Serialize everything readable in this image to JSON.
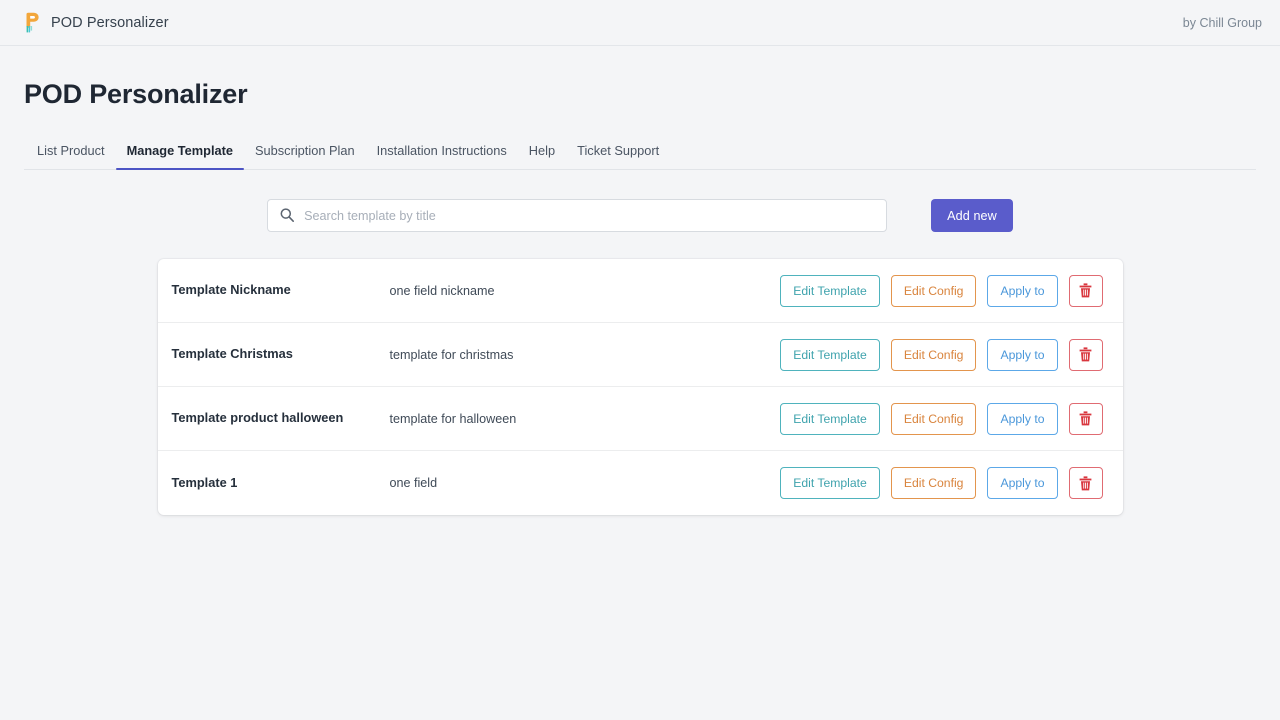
{
  "topbar": {
    "logo_icon": "pod-logo-icon",
    "brand_name": "POD Personalizer",
    "byline": "by Chill Group"
  },
  "page": {
    "title": "POD Personalizer"
  },
  "tabs": [
    {
      "label": "List Product",
      "active": false
    },
    {
      "label": "Manage Template",
      "active": true
    },
    {
      "label": "Subscription Plan",
      "active": false
    },
    {
      "label": "Installation Instructions",
      "active": false
    },
    {
      "label": "Help",
      "active": false
    },
    {
      "label": "Ticket Support",
      "active": false
    }
  ],
  "toolbar": {
    "search": {
      "icon": "search-icon",
      "value": "",
      "placeholder": "Search template by title"
    },
    "add_new_label": "Add new"
  },
  "table": {
    "rows": [
      {
        "title": "Template Nickname",
        "description": "one field nickname",
        "actions": {
          "edit_template": "Edit Template",
          "edit_config": "Edit Config",
          "apply_to": "Apply to",
          "delete_icon": "trash-icon"
        }
      },
      {
        "title": "Template Christmas",
        "description": "template for christmas",
        "actions": {
          "edit_template": "Edit Template",
          "edit_config": "Edit Config",
          "apply_to": "Apply to",
          "delete_icon": "trash-icon"
        }
      },
      {
        "title": "Template product halloween",
        "description": "template for halloween",
        "actions": {
          "edit_template": "Edit Template",
          "edit_config": "Edit Config",
          "apply_to": "Apply to",
          "delete_icon": "trash-icon"
        }
      },
      {
        "title": "Template 1",
        "description": "one field",
        "actions": {
          "edit_template": "Edit Template",
          "edit_config": "Edit Config",
          "apply_to": "Apply to",
          "delete_icon": "trash-icon"
        }
      }
    ]
  },
  "colors": {
    "page_background": "#f4f5f7",
    "card_background": "#ffffff",
    "accent_primary": "#5a5ccb",
    "tab_underline": "#4c54c4",
    "edit_template_border": "#4fb3bd",
    "edit_config_border": "#e3954d",
    "apply_to_border": "#5ca8e8",
    "delete_border": "#e06b72",
    "delete_icon": "#d9363e",
    "logo_primary": "#f2a63b",
    "logo_secondary": "#3bbfb0"
  }
}
